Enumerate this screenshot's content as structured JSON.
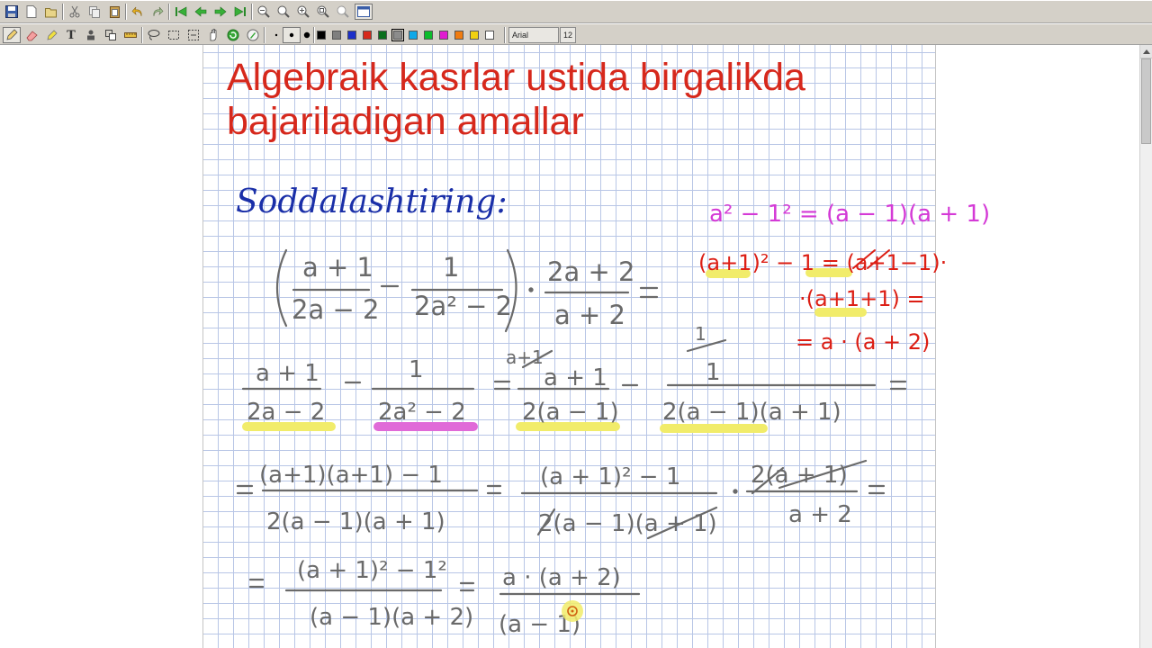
{
  "toolbar_main": {
    "buttons": [
      "save-icon",
      "new-page-icon",
      "open-icon",
      "cut-icon",
      "copy-icon",
      "paste-icon",
      "undo-icon",
      "redo-icon",
      "first-page-icon",
      "previous-page-icon",
      "next-page-icon",
      "last-page-icon",
      "zoom-out-icon",
      "zoom-in-icon",
      "zoom-plus-icon",
      "zoom-fit-icon",
      "zoom-page-icon",
      "fullscreen-icon"
    ]
  },
  "toolbar_tools": {
    "font_name": "Arial Normal",
    "font_size": "12",
    "colors": [
      "#000000",
      "#7f7f7f",
      "#1c2fc8",
      "#d62a1c",
      "#0a6e1c",
      "#8c8c8c",
      "#10a8e8",
      "#0cbc2c",
      "#e01cd0",
      "#f07c10",
      "#f0d010",
      "#ffffff"
    ],
    "selected_color": "#8c8c8c"
  },
  "document": {
    "title_line1": "Algebraik kasrlar ustida birgalikda",
    "title_line2": "bajariladigan amallar",
    "task_label": "Soddalashtiring:"
  },
  "ink_colors": {
    "grey": "#6a6a6a",
    "blue": "#1a2fa8",
    "red": "#dc1e14",
    "magenta": "#d43ad6",
    "title_red": "#d6281c",
    "highlight_yellow": "#f1ec6a",
    "highlight_pink": "#e06ad8"
  }
}
